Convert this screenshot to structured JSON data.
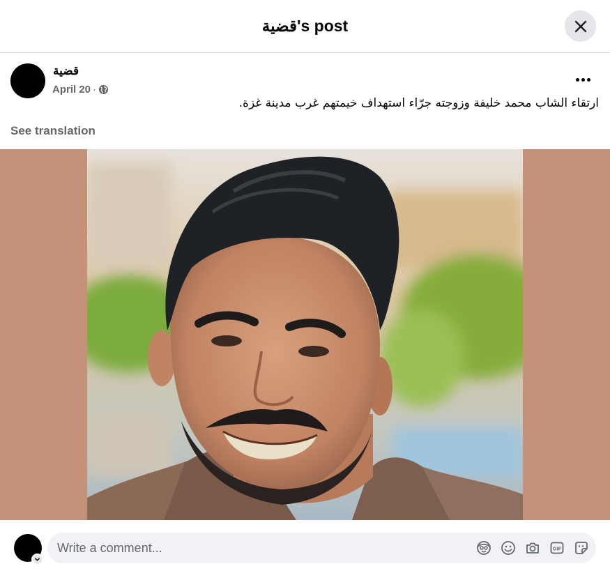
{
  "header": {
    "title": "قضية's post",
    "close_icon": "close-icon"
  },
  "post": {
    "author": "قضية",
    "date": "April 20",
    "separator": "·",
    "privacy_icon": "globe-icon",
    "text": "ارتقاء الشاب محمد خليفة وزوجته جرّاء استهداف خيمتهم غرب مدينة غزة.",
    "see_translation": "See translation",
    "more_icon": "more-options-icon"
  },
  "photo": {
    "background_color": "#c39279"
  },
  "comment": {
    "placeholder": "Write a comment...",
    "icons": [
      "avatar-sticker-icon",
      "emoji-icon",
      "camera-icon",
      "gif-icon",
      "sticker-icon"
    ]
  }
}
